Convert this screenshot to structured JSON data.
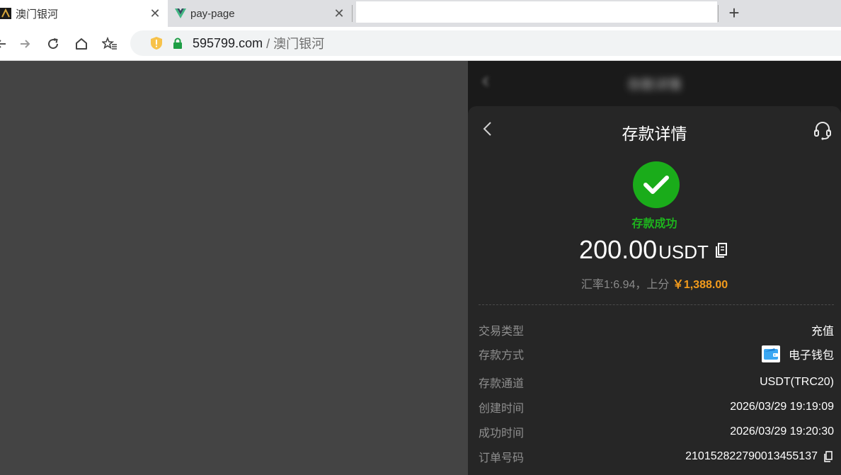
{
  "browser": {
    "tabs": [
      {
        "title": "澳门银河",
        "close": "✕",
        "active": true
      },
      {
        "title": "pay-page",
        "close": "✕",
        "active": false
      }
    ],
    "new_tab": "+",
    "address": {
      "host": "595799.com",
      "path": "/ 澳门银河"
    }
  },
  "page": {
    "header_title_blurred": "存款详情",
    "title": "存款详情",
    "status": "存款成功",
    "amount": "200.00",
    "currency": "USDT",
    "rate_text": "汇率1:6.94，上分",
    "credit": "￥1,388.00",
    "details": [
      {
        "label": "交易类型",
        "value": "充值"
      },
      {
        "label": "存款方式",
        "value": "电子钱包"
      },
      {
        "label": "存款通道",
        "value": "USDT(TRC20)"
      },
      {
        "label": "创建时间",
        "value": "2026/03/29 19:19:09"
      },
      {
        "label": "成功时间",
        "value": "2026/03/29 19:20:30"
      },
      {
        "label": "订单号码",
        "value": "210152822790013455137"
      }
    ],
    "colors": {
      "success": "#1aac1a",
      "credit": "#f39b1c",
      "sheet": "#262626"
    }
  }
}
